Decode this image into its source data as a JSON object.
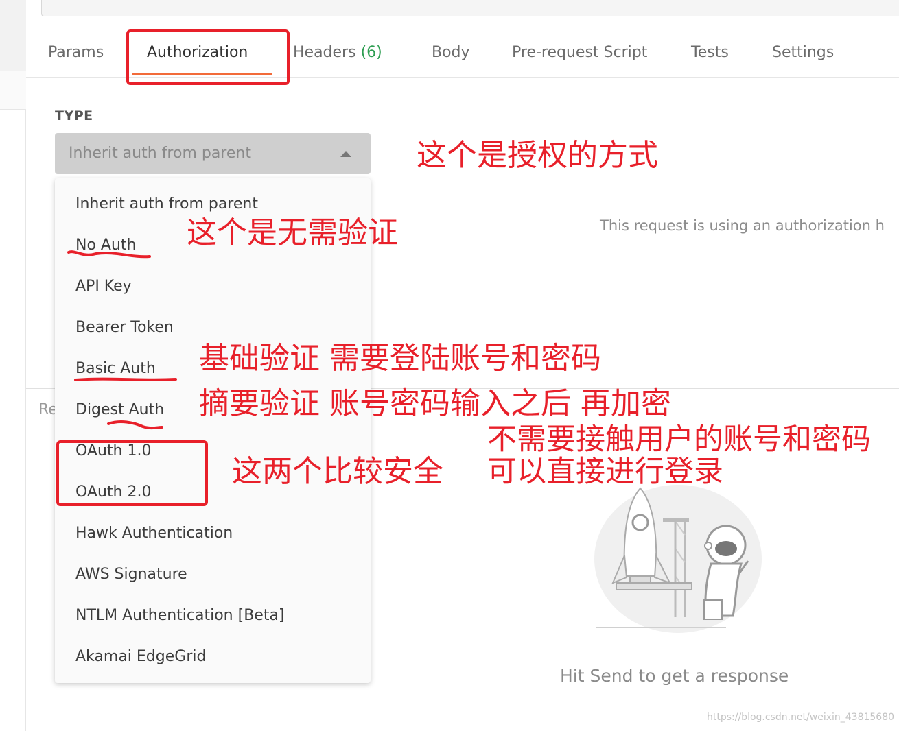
{
  "tabs": [
    {
      "label": "Params"
    },
    {
      "label": "Authorization"
    },
    {
      "label": "Headers",
      "count": "(6)"
    },
    {
      "label": "Body"
    },
    {
      "label": "Pre-request Script"
    },
    {
      "label": "Tests"
    },
    {
      "label": "Settings"
    }
  ],
  "auth": {
    "type_label": "TYPE",
    "selected": "Inherit auth from parent",
    "options": [
      "Inherit auth from parent",
      "No Auth",
      "API Key",
      "Bearer Token",
      "Basic Auth",
      "Digest Auth",
      "OAuth 1.0",
      "OAuth 2.0",
      "Hawk Authentication",
      "AWS Signature",
      "NTLM Authentication [Beta]",
      "Akamai EdgeGrid"
    ]
  },
  "right_panel": {
    "info_text": "This request is using an authorization h"
  },
  "response": {
    "label": "Re",
    "hint": "Hit Send to get a response"
  },
  "annotations": {
    "auth_method": "这个是授权的方式",
    "no_auth": "这个是无需验证",
    "basic_auth": "基础验证 需要登陆账号和密码",
    "digest_auth": "摘要验证  账号密码输入之后 再加密",
    "oauth_safe": "这两个比较安全",
    "oauth_desc_1": "不需要接触用户的账号和密码",
    "oauth_desc_2": "可以直接进行登录"
  },
  "watermark": "https://blog.csdn.net/weixin_43815680",
  "colors": {
    "accent": "#f26b3a",
    "annotation": "#e8202a",
    "count_green": "#2e9e52"
  }
}
